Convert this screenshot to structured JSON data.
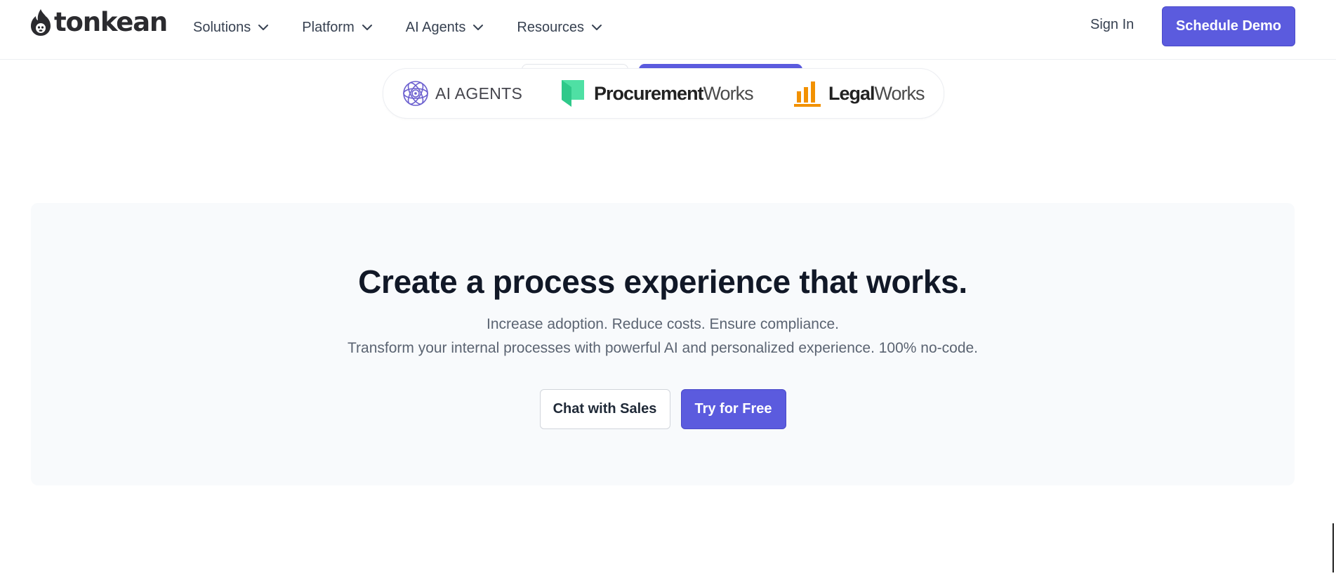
{
  "header": {
    "logo_text": "tonkean",
    "nav": [
      {
        "label": "Solutions"
      },
      {
        "label": "Platform"
      },
      {
        "label": "AI Agents"
      },
      {
        "label": "Resources"
      }
    ],
    "sign_in": "Sign In",
    "schedule_demo": "Schedule Demo"
  },
  "products": {
    "ai_agents": "AI AGENTS",
    "procurement": {
      "strong": "Procurement",
      "light": "Works"
    },
    "legal": {
      "strong": "Legal",
      "light": "Works"
    }
  },
  "cta": {
    "headline": "Create a process experience that works.",
    "sub1": "Increase adoption. Reduce costs. Ensure compliance.",
    "sub2": "Transform your internal processes with powerful AI and personalized experience. 100% no-code.",
    "chat_sales": "Chat with Sales",
    "try_free": "Try for Free"
  },
  "colors": {
    "accent": "#5b5bde",
    "procurement_green": "#4fe0a4",
    "legal_orange": "#f29100",
    "panel_bg": "#f8fafc"
  },
  "icons": {
    "logo": "flame-monkey-logo-icon",
    "dropdown": "chevron-down-icon",
    "ai_agents": "orbit-sphere-icon",
    "procurement": "document-bookmark-icon",
    "legal": "bar-chart-icon"
  }
}
